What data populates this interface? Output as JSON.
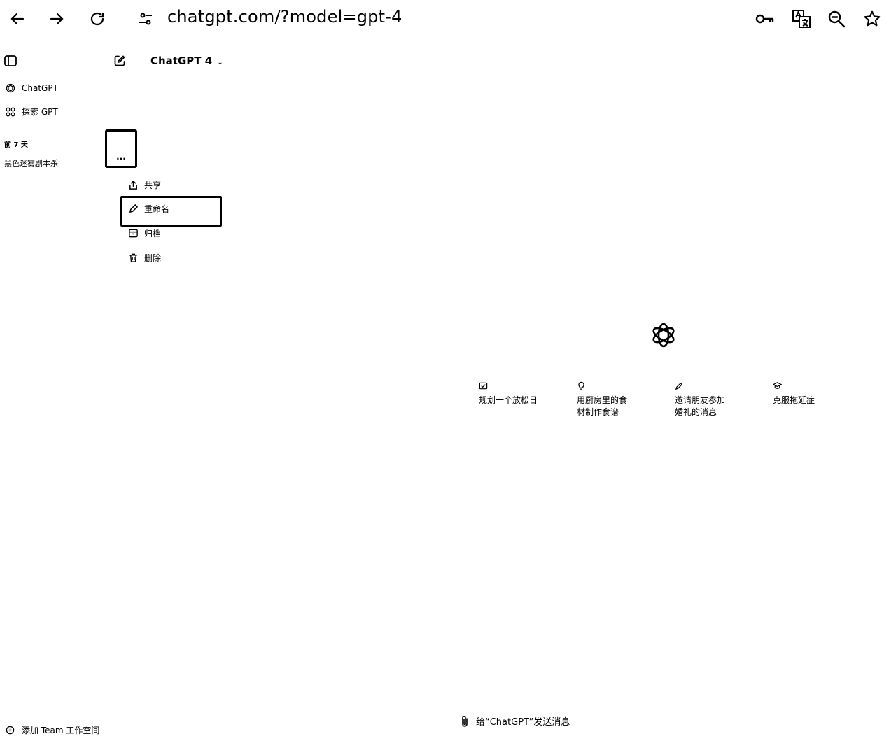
{
  "browser": {
    "url": "chatgpt.com/?model=gpt-4",
    "icons": [
      "back-icon",
      "forward-icon",
      "reload-icon",
      "site-settings-icon",
      "key-icon",
      "translate-icon",
      "zoom-out-icon",
      "star-icon"
    ]
  },
  "sidebar": {
    "items": [
      {
        "label": "ChatGPT"
      },
      {
        "label": "探索 GPT"
      }
    ],
    "section_label": "前 7 天",
    "conversation": "黑色迷雾剧本杀",
    "more_label": "...",
    "footer": "添加 Team 工作空间"
  },
  "header": {
    "model_label": "ChatGPT 4"
  },
  "context_menu": {
    "items": [
      {
        "label": "共享",
        "icon": "share-icon"
      },
      {
        "label": "重命名",
        "icon": "pencil-icon"
      },
      {
        "label": "归档",
        "icon": "archive-icon"
      },
      {
        "label": "删除",
        "icon": "trash-icon"
      }
    ]
  },
  "suggestions": [
    {
      "line1": "规划一个放松日",
      "line2": "",
      "icon": "plan-icon"
    },
    {
      "line1": "用厨房里的食",
      "line2": "材制作食谱",
      "icon": "bulb-icon"
    },
    {
      "line1": "邀请朋友参加",
      "line2": "婚礼的消息",
      "icon": "pen-icon"
    },
    {
      "line1": "克服拖延症",
      "line2": "",
      "icon": "cap-icon"
    }
  ],
  "composer": {
    "placeholder": "给“ChatGPT”发送消息"
  }
}
